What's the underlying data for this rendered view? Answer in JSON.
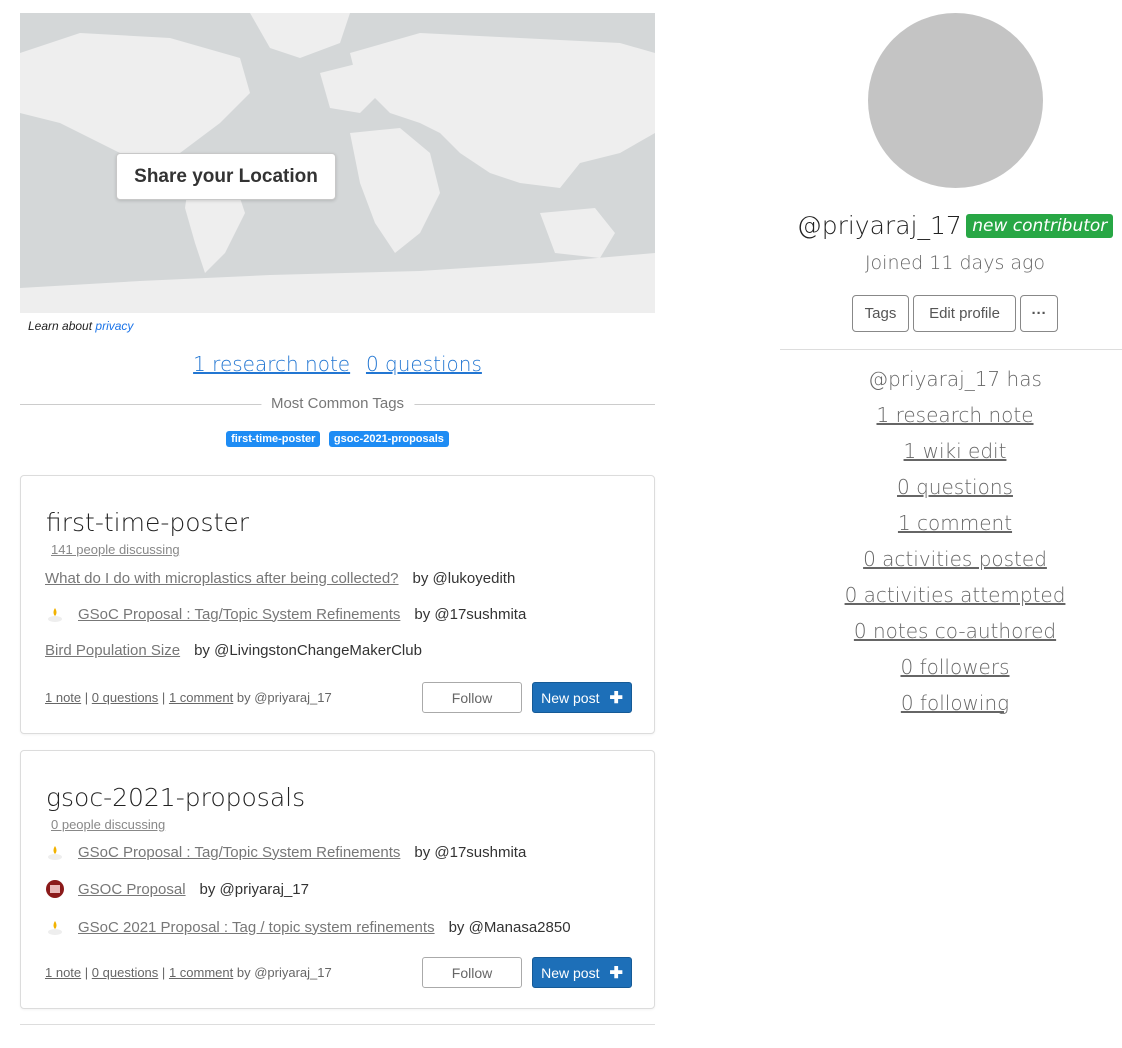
{
  "map": {
    "share_label": "Share your Location",
    "privacy_prefix": "Learn about",
    "privacy_link": "privacy"
  },
  "counts": {
    "research_notes": "1 research note",
    "questions": "0 questions"
  },
  "common_tags": {
    "label": "Most Common Tags",
    "chips": [
      "first-time-poster",
      "gsoc-2021-proposals"
    ]
  },
  "cards": [
    {
      "title": "first-time-poster",
      "people": "141 people discussing",
      "posts": [
        {
          "title": "What do I do with microplastics after being collected?",
          "author": "by @lukoyedith",
          "icon": "none"
        },
        {
          "title": "GSoC Proposal : Tag/Topic System Refinements",
          "author": "by @17sushmita",
          "icon": "candle-icon"
        },
        {
          "title": "Bird Population Size",
          "author": "by @LivingstonChangeMakerClub",
          "icon": "none"
        }
      ],
      "footer": {
        "note": "1 note",
        "questions": "0 questions",
        "comment": "1 comment",
        "by": "by @priyaraj_17",
        "sep": "|"
      },
      "follow": "Follow",
      "new_post": "New post"
    },
    {
      "title": "gsoc-2021-proposals",
      "people": "0 people discussing",
      "posts": [
        {
          "title": "GSoC Proposal : Tag/Topic System Refinements",
          "author": "by @17sushmita",
          "icon": "candle-icon"
        },
        {
          "title": "GSOC Proposal",
          "author": "by @priyaraj_17",
          "icon": "avatar-icon"
        },
        {
          "title": "GSoC 2021 Proposal : Tag / topic system refinements",
          "author": "by @Manasa2850",
          "icon": "candle-icon"
        }
      ],
      "footer": {
        "note": "1 note",
        "questions": "0 questions",
        "comment": "1 comment",
        "by": "by @priyaraj_17",
        "sep": "|"
      },
      "follow": "Follow",
      "new_post": "New post"
    }
  ],
  "profile": {
    "username": "@priyaraj_17",
    "badge": "new contributor",
    "joined": "Joined 11 days ago",
    "buttons": {
      "tags": "Tags",
      "edit": "Edit profile",
      "more": "···"
    },
    "stats_head": "@priyaraj_17 has",
    "stats": [
      "1 research note",
      "1 wiki edit",
      "0 questions",
      "1 comment",
      "0 activities posted",
      "0 activities attempted",
      "0 notes co-authored",
      "0 followers",
      "0 following"
    ]
  },
  "colors": {
    "accent": "#2276d2",
    "chip": "#1e8cf4",
    "badge": "#28a745",
    "new_post": "#1d6fb8"
  }
}
